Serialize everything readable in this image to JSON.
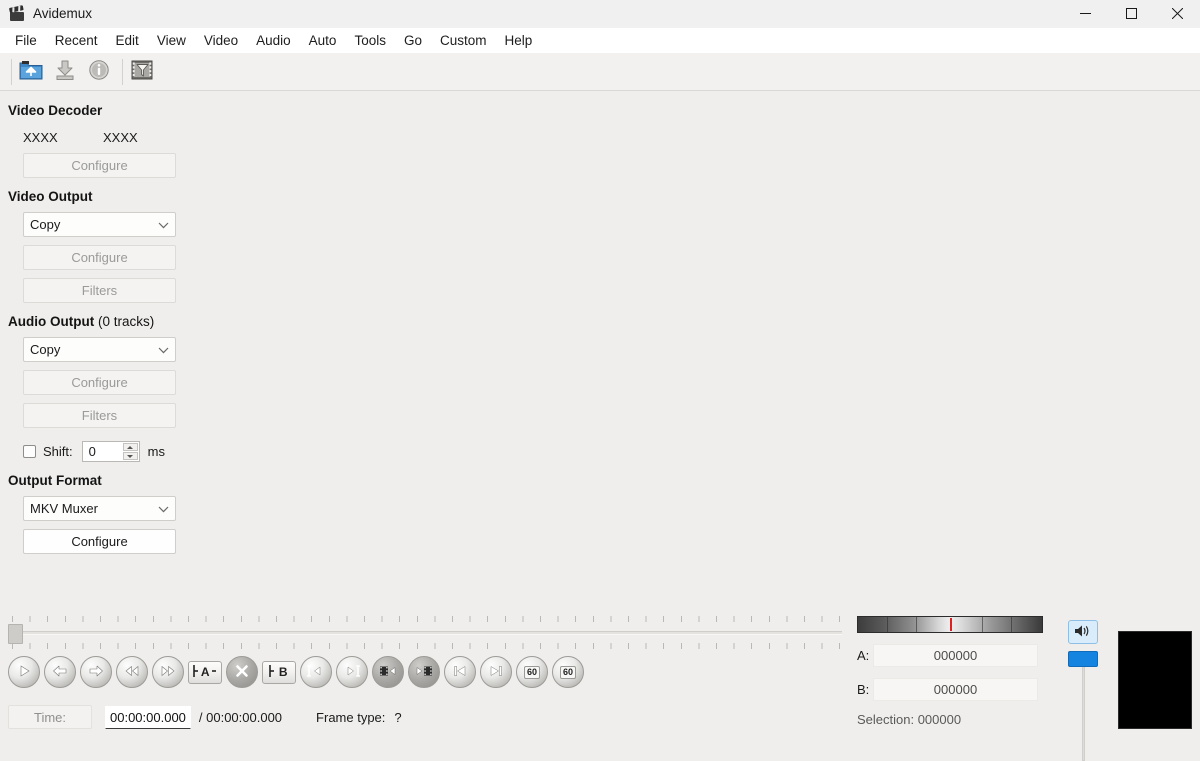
{
  "window": {
    "title": "Avidemux",
    "icon": "clapperboard-icon",
    "controls": {
      "minimize": "—",
      "maximize": "☐",
      "close": "✕"
    }
  },
  "menubar": {
    "items": [
      {
        "label": "File"
      },
      {
        "label": "Recent"
      },
      {
        "label": "Edit"
      },
      {
        "label": "View"
      },
      {
        "label": "Video"
      },
      {
        "label": "Audio"
      },
      {
        "label": "Auto"
      },
      {
        "label": "Tools"
      },
      {
        "label": "Go"
      },
      {
        "label": "Custom"
      },
      {
        "label": "Help"
      }
    ]
  },
  "toolbar": {
    "buttons": [
      {
        "name": "open-file-icon",
        "title": "Open"
      },
      {
        "name": "save-icon",
        "title": "Save"
      },
      {
        "name": "info-icon",
        "title": "Information"
      },
      {
        "name": "filters-film-icon",
        "title": "Filters"
      }
    ]
  },
  "panel": {
    "video_decoder": {
      "title": "Video Decoder",
      "value_left": "XXXX",
      "value_right": "XXXX",
      "configure_label": "Configure"
    },
    "video_output": {
      "title": "Video Output",
      "codec": "Copy",
      "configure_label": "Configure",
      "filters_label": "Filters"
    },
    "audio_output": {
      "title": "Audio Output",
      "tracks": "(0 tracks)",
      "codec": "Copy",
      "configure_label": "Configure",
      "filters_label": "Filters",
      "shift_label": "Shift:",
      "shift_value": "0",
      "shift_unit": "ms"
    },
    "output_format": {
      "title": "Output Format",
      "muxer": "MKV Muxer",
      "configure_label": "Configure"
    }
  },
  "transport": {
    "buttons": [
      {
        "name": "play-button",
        "icon": "play"
      },
      {
        "name": "step-backward-button",
        "icon": "arrow-left"
      },
      {
        "name": "step-forward-button",
        "icon": "arrow-right"
      },
      {
        "name": "rewind-button",
        "icon": "double-left"
      },
      {
        "name": "fast-forward-button",
        "icon": "double-right"
      },
      {
        "name": "mark-a-button",
        "icon": "marker-a",
        "label": "A"
      },
      {
        "name": "delete-selection-button",
        "icon": "cross"
      },
      {
        "name": "mark-b-button",
        "icon": "marker-b",
        "label": "B"
      },
      {
        "name": "previous-keyframe-button",
        "icon": "key-left"
      },
      {
        "name": "next-keyframe-button",
        "icon": "key-right"
      },
      {
        "name": "previous-blackframe-button",
        "icon": "black-left"
      },
      {
        "name": "next-blackframe-button",
        "icon": "black-right"
      },
      {
        "name": "go-to-start-button",
        "icon": "skip-start"
      },
      {
        "name": "go-to-end-button",
        "icon": "skip-end"
      },
      {
        "name": "back-60-button",
        "icon": "sixty",
        "label": "60"
      },
      {
        "name": "forward-60-button",
        "icon": "sixty",
        "label": "60"
      }
    ]
  },
  "timebar": {
    "time_button_label": "Time:",
    "current_time": "00:00:00.000",
    "total_time": "/ 00:00:00.000",
    "frame_type_label": "Frame type:",
    "frame_type_value": "?"
  },
  "markers": {
    "a_label": "A:",
    "a_value": "000000",
    "b_label": "B:",
    "b_value": "000000",
    "selection": "Selection: 000000"
  },
  "volume": {
    "icon": "speaker-icon"
  },
  "colors": {
    "background": "#efeeec",
    "titlebar": "#f0f0f0",
    "menubar": "#ffffff",
    "accent_blue": "#1583e0",
    "marker_red": "#e02020",
    "preview_black": "#000000"
  }
}
